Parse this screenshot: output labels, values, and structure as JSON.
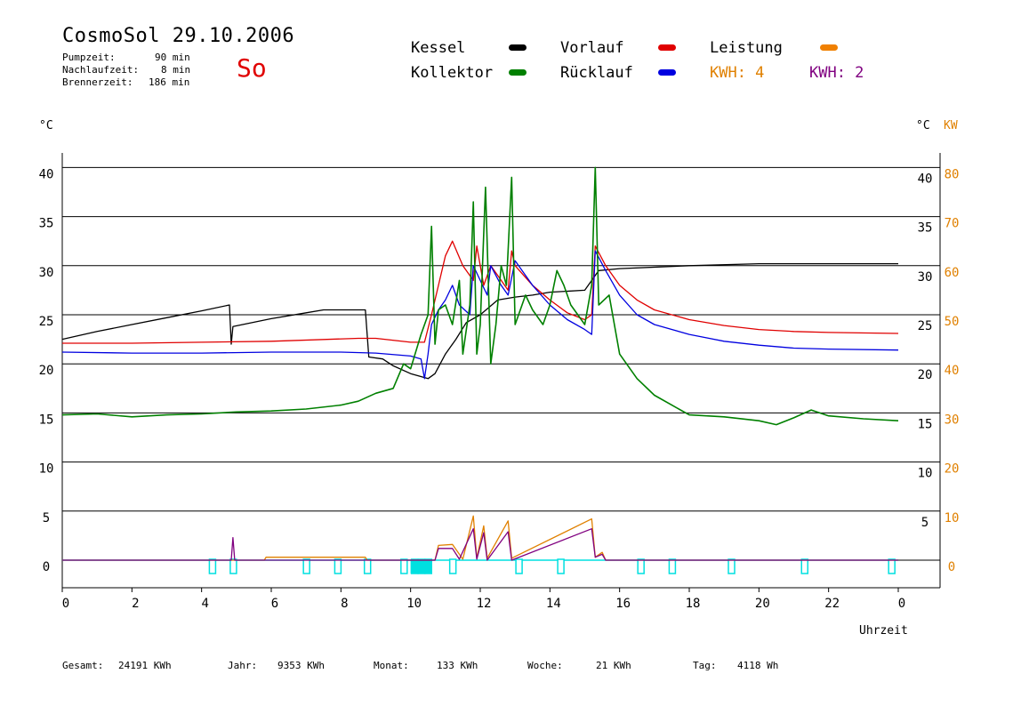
{
  "header": {
    "title": "CosmoSol 29.10.2006",
    "day": "So",
    "pump_label": "Pumpzeit:",
    "pump_value": "90 min",
    "after_label": "Nachlaufzeit:",
    "after_value": "8 min",
    "burner_label": "Brennerzeit:",
    "burner_value": "186 min"
  },
  "legend": {
    "kessel": {
      "label": "Kessel",
      "color": "#000000"
    },
    "kollektor": {
      "label": "Kollektor",
      "color": "#008000"
    },
    "vorlauf": {
      "label": "Vorlauf",
      "color": "#e00000"
    },
    "ruecklauf": {
      "label": "Rücklauf",
      "color": "#0000e0"
    },
    "leistung": {
      "label": "Leistung",
      "color": "#f08000"
    },
    "kwh1": {
      "label": "KWH: 4",
      "color": "#e08000"
    },
    "kwh2": {
      "label": "KWH: 2",
      "color": "#800080"
    }
  },
  "axes": {
    "left_unit": "°C",
    "right_unit_c": "°C",
    "right_unit_kw": "KW",
    "x_label": "Uhrzeit"
  },
  "footer": {
    "gesamt_label": "Gesamt:",
    "gesamt_value": "24191 KWh",
    "jahr_label": "Jahr:",
    "jahr_value": "9353 KWh",
    "monat_label": "Monat:",
    "monat_value": "133 KWh",
    "woche_label": "Woche:",
    "woche_value": "21 KWh",
    "tag_label": "Tag:",
    "tag_value": "4118 Wh"
  },
  "chart_data": {
    "type": "line",
    "title": "CosmoSol 29.10.2006",
    "xlabel": "Uhrzeit",
    "ylabel": "°C",
    "xlim": [
      0,
      24
    ],
    "ylim": [
      -3,
      43
    ],
    "grid": true,
    "x_ticks": [
      "0",
      "2",
      "4",
      "6",
      "8",
      "10",
      "12",
      "14",
      "16",
      "18",
      "20",
      "22",
      "0"
    ],
    "y_ticks_left": [
      "0",
      "5",
      "10",
      "15",
      "20",
      "25",
      "30",
      "35",
      "40"
    ],
    "y_ticks_right_c": [
      "5",
      "10",
      "15",
      "20",
      "25",
      "30",
      "35",
      "40"
    ],
    "y_ticks_right_kw": [
      "0",
      "10",
      "20",
      "30",
      "40",
      "50",
      "60",
      "70",
      "80"
    ],
    "series": [
      {
        "name": "Kessel",
        "color": "#000000",
        "points": [
          [
            0,
            22.5
          ],
          [
            1,
            23.3
          ],
          [
            2,
            24
          ],
          [
            3,
            24.7
          ],
          [
            4,
            25.4
          ],
          [
            4.8,
            26
          ],
          [
            4.85,
            22
          ],
          [
            4.9,
            23.8
          ],
          [
            6,
            24.6
          ],
          [
            7,
            25.2
          ],
          [
            7.5,
            25.5
          ],
          [
            8.7,
            25.5
          ],
          [
            8.8,
            20.7
          ],
          [
            9.2,
            20.5
          ],
          [
            9.5,
            19.8
          ],
          [
            10,
            19
          ],
          [
            10.5,
            18.5
          ],
          [
            10.7,
            19
          ],
          [
            11,
            21
          ],
          [
            11.3,
            22.5
          ],
          [
            11.6,
            24.2
          ],
          [
            12,
            25
          ],
          [
            12.5,
            26.5
          ],
          [
            13,
            26.8
          ],
          [
            13.5,
            27
          ],
          [
            14,
            27.3
          ],
          [
            15,
            27.5
          ],
          [
            15.2,
            28.5
          ],
          [
            15.4,
            29.5
          ],
          [
            16,
            29.7
          ],
          [
            18,
            30
          ],
          [
            20,
            30.2
          ],
          [
            24,
            30.2
          ]
        ]
      },
      {
        "name": "Vorlauf",
        "color": "#e00000",
        "points": [
          [
            0,
            22.1
          ],
          [
            2,
            22.1
          ],
          [
            4,
            22.2
          ],
          [
            6,
            22.3
          ],
          [
            8.5,
            22.6
          ],
          [
            9,
            22.6
          ],
          [
            10,
            22.2
          ],
          [
            10.4,
            22.2
          ],
          [
            10.6,
            25
          ],
          [
            10.8,
            28
          ],
          [
            11,
            31
          ],
          [
            11.2,
            32.5
          ],
          [
            11.5,
            30
          ],
          [
            11.8,
            28.5
          ],
          [
            11.9,
            32
          ],
          [
            12.1,
            28
          ],
          [
            12.3,
            30
          ],
          [
            12.5,
            29
          ],
          [
            12.8,
            27.5
          ],
          [
            12.9,
            31.5
          ],
          [
            13,
            30
          ],
          [
            13.5,
            28
          ],
          [
            14,
            26.5
          ],
          [
            14.5,
            25.2
          ],
          [
            15,
            24.5
          ],
          [
            15.2,
            25
          ],
          [
            15.3,
            32
          ],
          [
            15.6,
            30
          ],
          [
            16,
            28
          ],
          [
            16.5,
            26.5
          ],
          [
            17,
            25.5
          ],
          [
            18,
            24.5
          ],
          [
            19,
            23.9
          ],
          [
            20,
            23.5
          ],
          [
            21,
            23.3
          ],
          [
            22,
            23.2
          ],
          [
            24,
            23.1
          ]
        ]
      },
      {
        "name": "Rücklauf",
        "color": "#0000e0",
        "points": [
          [
            0,
            21.2
          ],
          [
            2,
            21.1
          ],
          [
            4,
            21.1
          ],
          [
            6,
            21.2
          ],
          [
            8,
            21.2
          ],
          [
            9,
            21.1
          ],
          [
            10,
            20.8
          ],
          [
            10.3,
            20.5
          ],
          [
            10.4,
            18.5
          ],
          [
            10.5,
            21
          ],
          [
            10.6,
            24
          ],
          [
            10.8,
            25.5
          ],
          [
            11,
            26.5
          ],
          [
            11.2,
            28
          ],
          [
            11.4,
            26
          ],
          [
            11.7,
            25
          ],
          [
            11.8,
            30
          ],
          [
            12,
            28.5
          ],
          [
            12.2,
            27
          ],
          [
            12.3,
            30
          ],
          [
            12.6,
            28
          ],
          [
            12.8,
            27
          ],
          [
            13,
            30.5
          ],
          [
            13.5,
            28
          ],
          [
            14,
            26
          ],
          [
            14.5,
            24.5
          ],
          [
            15,
            23.5
          ],
          [
            15.2,
            23
          ],
          [
            15.3,
            31.5
          ],
          [
            15.6,
            29.5
          ],
          [
            16,
            27
          ],
          [
            16.5,
            25
          ],
          [
            17,
            24
          ],
          [
            18,
            23
          ],
          [
            19,
            22.3
          ],
          [
            20,
            21.9
          ],
          [
            21,
            21.6
          ],
          [
            22,
            21.5
          ],
          [
            24,
            21.4
          ]
        ]
      },
      {
        "name": "Kollektor",
        "color": "#008000",
        "points": [
          [
            0,
            14.8
          ],
          [
            1,
            14.9
          ],
          [
            2,
            14.6
          ],
          [
            3,
            14.8
          ],
          [
            4,
            14.9
          ],
          [
            5,
            15.1
          ],
          [
            6,
            15.2
          ],
          [
            7,
            15.4
          ],
          [
            8,
            15.8
          ],
          [
            8.5,
            16.2
          ],
          [
            9,
            17
          ],
          [
            9.5,
            17.5
          ],
          [
            9.8,
            20
          ],
          [
            10,
            19.5
          ],
          [
            10.3,
            23
          ],
          [
            10.5,
            25
          ],
          [
            10.6,
            34
          ],
          [
            10.7,
            22
          ],
          [
            10.8,
            25.5
          ],
          [
            11,
            26
          ],
          [
            11.2,
            24
          ],
          [
            11.4,
            28.5
          ],
          [
            11.5,
            21
          ],
          [
            11.7,
            26
          ],
          [
            11.8,
            36.5
          ],
          [
            11.9,
            21
          ],
          [
            12,
            24
          ],
          [
            12.15,
            38
          ],
          [
            12.3,
            20
          ],
          [
            12.45,
            24
          ],
          [
            12.6,
            30
          ],
          [
            12.75,
            28
          ],
          [
            12.9,
            39
          ],
          [
            13,
            24
          ],
          [
            13.1,
            25
          ],
          [
            13.3,
            27
          ],
          [
            13.5,
            25.5
          ],
          [
            13.8,
            24
          ],
          [
            14,
            26
          ],
          [
            14.2,
            29.5
          ],
          [
            14.4,
            28
          ],
          [
            14.6,
            26
          ],
          [
            14.8,
            25
          ],
          [
            15,
            24
          ],
          [
            15.2,
            28
          ],
          [
            15.3,
            40
          ],
          [
            15.4,
            26
          ],
          [
            15.7,
            27
          ],
          [
            16,
            21
          ],
          [
            16.5,
            18.5
          ],
          [
            17,
            16.8
          ],
          [
            17.5,
            15.8
          ],
          [
            18,
            14.8
          ],
          [
            19,
            14.6
          ],
          [
            20,
            14.2
          ],
          [
            20.5,
            13.8
          ],
          [
            21,
            14.5
          ],
          [
            21.5,
            15.3
          ],
          [
            22,
            14.7
          ],
          [
            23,
            14.4
          ],
          [
            24,
            14.2
          ]
        ]
      },
      {
        "name": "Leistung",
        "color": "#e08000",
        "points": [
          [
            0,
            0
          ],
          [
            5.8,
            0
          ],
          [
            5.85,
            0.3
          ],
          [
            8.7,
            0.3
          ],
          [
            8.75,
            0
          ],
          [
            10.7,
            0
          ],
          [
            10.8,
            1.5
          ],
          [
            11.2,
            1.6
          ],
          [
            11.5,
            0.1
          ],
          [
            11.8,
            4.5
          ],
          [
            11.9,
            0.2
          ],
          [
            12.1,
            3.5
          ],
          [
            12.2,
            0.2
          ],
          [
            12.8,
            4
          ],
          [
            12.9,
            0.2
          ],
          [
            15.2,
            4.2
          ],
          [
            15.3,
            0.3
          ],
          [
            15.5,
            0.8
          ],
          [
            15.6,
            0
          ],
          [
            24,
            0
          ]
        ]
      },
      {
        "name": "KWH",
        "color": "#800080",
        "points": [
          [
            0,
            0
          ],
          [
            4.85,
            0
          ],
          [
            4.9,
            2.3
          ],
          [
            4.95,
            0
          ],
          [
            10.7,
            0
          ],
          [
            10.8,
            1.2
          ],
          [
            11.2,
            1.2
          ],
          [
            11.4,
            0.1
          ],
          [
            11.8,
            3.2
          ],
          [
            11.9,
            0.1
          ],
          [
            12.1,
            2.8
          ],
          [
            12.2,
            0
          ],
          [
            12.8,
            2.9
          ],
          [
            12.9,
            0
          ],
          [
            15.2,
            3.2
          ],
          [
            15.3,
            0.3
          ],
          [
            15.5,
            0.6
          ],
          [
            15.6,
            0
          ],
          [
            24,
            0
          ]
        ]
      }
    ],
    "status_markers": [
      4.3,
      4.9,
      7,
      7.9,
      8.75,
      9.8,
      10.1,
      10.3,
      10.5,
      11.2,
      13.1,
      14.3,
      16.6,
      17.5,
      19.2,
      21.3,
      23.8
    ],
    "status_block": [
      10.0,
      10.6
    ],
    "status_color": "#00e0e0"
  }
}
